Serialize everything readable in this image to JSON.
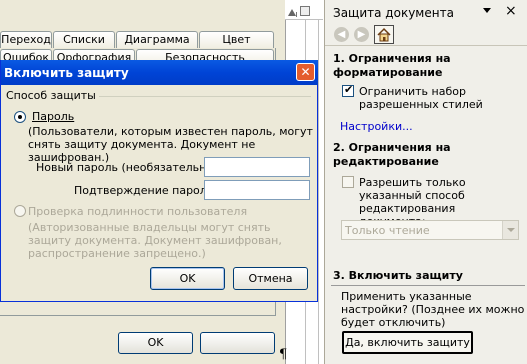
{
  "options_dialog": {
    "tabs_row1": [
      "Переход",
      "Списки",
      "Диаграмма",
      "Цвет"
    ],
    "tabs_row2": [
      "Ошибок",
      "Орфография",
      "Безопасность"
    ],
    "ok_label": "OK"
  },
  "task_pane": {
    "title": "Защита документа",
    "section1_title": "1. Ограничения на форматирование",
    "format_checkbox_label": "Ограничить набор разрешенных стилей",
    "format_checkbox_checked": true,
    "settings_link": "Настройки...",
    "section2_title": "2. Ограничения на редактирование",
    "edit_checkbox_label": "Разрешить только указанный способ редактирования документа:",
    "edit_checkbox_checked": false,
    "edit_mode_value": "Только чтение",
    "section3_title": "3. Включить защиту",
    "apply_text": "Применить указанные настройки? (Позднее их можно будет отключить)",
    "apply_button": "Да, включить защиту"
  },
  "protect_dialog": {
    "title": "Включить защиту",
    "group_label": "Способ защиты",
    "password_option": "Пароль",
    "password_selected": true,
    "password_desc": "(Пользователи, которым известен пароль, могут снять защиту документа. Документ не зашифрован.)",
    "new_password_label": "Новый пароль (необязательно):",
    "new_password_value": "",
    "confirm_password_label": "Подтверждение пароля:",
    "confirm_password_value": "",
    "auth_option": "Проверка подлинности пользователя",
    "auth_selected": false,
    "auth_desc": "(Авторизованные владельцы могут снять защиту документа. Документ зашифрован, распространение запрещено.)",
    "ok_label": "OK",
    "cancel_label": "Отмена"
  }
}
